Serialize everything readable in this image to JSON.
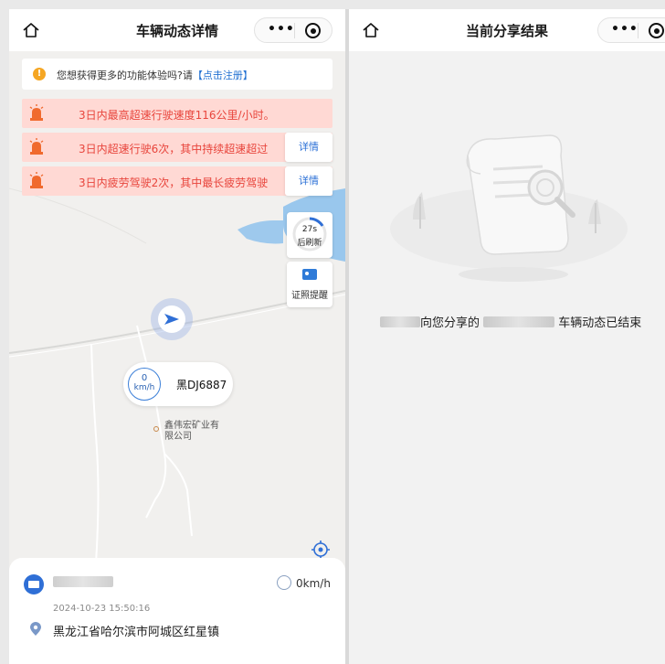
{
  "left_panel": {
    "title": "车辆动态详情",
    "notice": {
      "text": "您想获得更多的功能体验吗?请",
      "link": "【点击注册】"
    },
    "alerts": [
      {
        "text": "3日内最高超速行驶速度116公里/小时。",
        "detail": ""
      },
      {
        "text": "3日内超速行驶6次，其中持续超速超过",
        "detail": "详情"
      },
      {
        "text": "3日内疲劳驾驶2次，其中最长疲劳驾驶",
        "detail": "详情"
      }
    ],
    "refresh": {
      "seconds": "27s",
      "label": "后刷新"
    },
    "license_label": "证照提醒",
    "vehicle": {
      "speed_value": "0",
      "speed_unit": "km/h",
      "plate": "黑DJ6887"
    },
    "poi_name": "鑫伟宏矿业有限公司",
    "info": {
      "speed": "0km/h",
      "timestamp": "2024-10-23 15:50:16",
      "address": "黑龙江省哈尔滨市阿城区红星镇"
    }
  },
  "right_panel": {
    "title": "当前分享结果",
    "message_part1": "向您分享的",
    "message_part2": "车辆动态已结束"
  },
  "colors": {
    "alert_bg": "#ffd9d4",
    "alert_text": "#e8453c",
    "link": "#1f6fd1",
    "accent_blue": "#2f6fd6"
  },
  "icons": [
    "home-icon",
    "more-dots-icon",
    "target-icon",
    "warning-icon",
    "siren-icon",
    "refresh-ring-icon",
    "license-card-icon",
    "navigation-arrow-icon",
    "poi-dot-icon",
    "locate-icon",
    "truck-icon",
    "speedometer-icon",
    "location-pin-icon",
    "document-search-illustration"
  ]
}
